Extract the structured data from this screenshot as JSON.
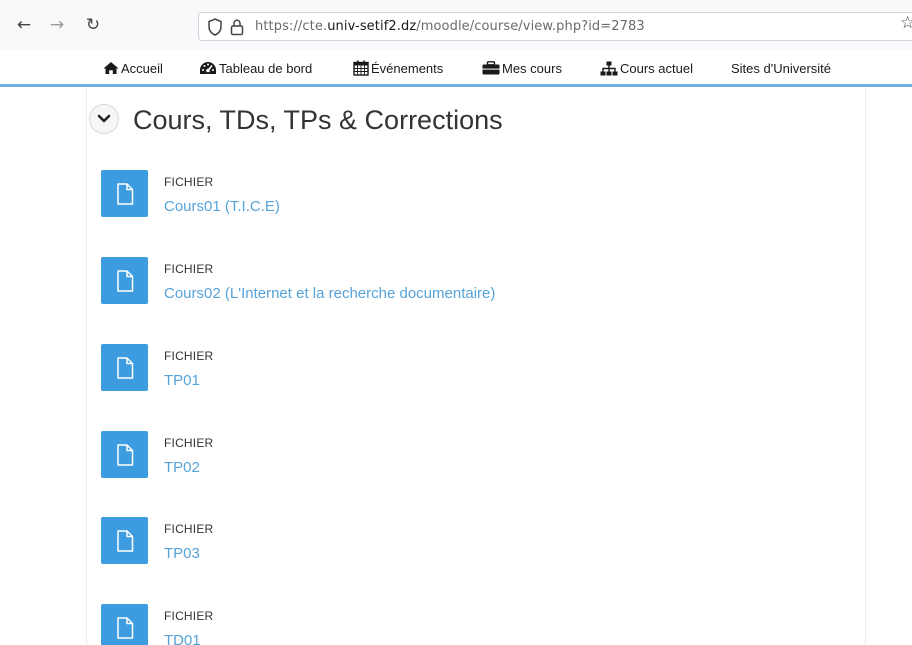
{
  "browser": {
    "url_prefix": "https://cte.",
    "url_domain": "univ-setif2.dz",
    "url_suffix": "/moodle/course/view.php?id=2783",
    "back_icon": "←",
    "forward_icon": "→",
    "reload_icon": "↻",
    "bookmark_icon": "☆"
  },
  "nav": {
    "items": [
      {
        "label": "Accueil",
        "icon": "home-icon"
      },
      {
        "label": "Tableau de bord",
        "icon": "dashboard-icon"
      },
      {
        "label": "Événements",
        "icon": "calendar-icon"
      },
      {
        "label": "Mes cours",
        "icon": "briefcase-icon"
      },
      {
        "label": "Cours actuel",
        "icon": "sitemap-icon"
      },
      {
        "label": "Sites d'Université",
        "icon": ""
      }
    ]
  },
  "section": {
    "title": "Cours, TDs, TPs & Corrections",
    "toggle_icon": "chevron-down-icon"
  },
  "activities": [
    {
      "type": "FICHIER",
      "name": "Cours01 (T.I.C.E)"
    },
    {
      "type": "FICHIER",
      "name": "Cours02 (L'Internet et la recherche documentaire)"
    },
    {
      "type": "FICHIER",
      "name": "TP01"
    },
    {
      "type": "FICHIER",
      "name": "TP02"
    },
    {
      "type": "FICHIER",
      "name": "TP03"
    },
    {
      "type": "FICHIER",
      "name": "TD01"
    }
  ],
  "colors": {
    "accent": "#3d9ce0",
    "link": "#56a3d9",
    "nav_border": "#6fb1de"
  }
}
